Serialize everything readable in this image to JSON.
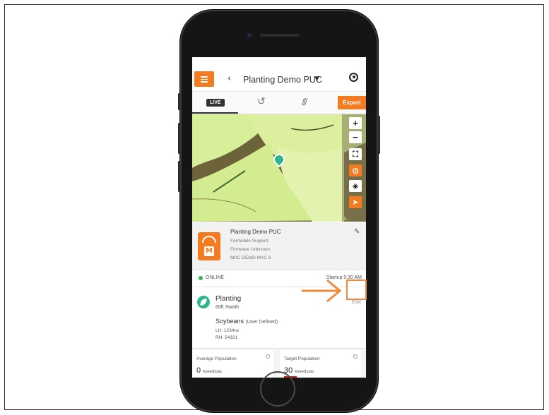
{
  "colors": {
    "accent": "#f47b20",
    "online": "#2fb55c",
    "crop_icon": "#2fb58b",
    "annotation": "#f08a3c"
  },
  "header": {
    "title": "Planting Demo PUC",
    "back_icon": "chevron-left-icon",
    "menu_icon": "hamburger-icon",
    "user_icon": "user-circle-icon"
  },
  "tabs": {
    "live_label": "LIVE",
    "history_icon": "history-icon",
    "coverage_icon": "stripes-icon",
    "export_label": "Export"
  },
  "map_controls": [
    {
      "name": "zoom-in-button",
      "glyph": "+"
    },
    {
      "name": "zoom-out-button",
      "glyph": "−"
    },
    {
      "name": "fullscreen-button",
      "glyph": "⛶"
    },
    {
      "name": "globe-button",
      "glyph": "◍"
    },
    {
      "name": "layers-button",
      "glyph": "◈"
    },
    {
      "name": "locate-button",
      "glyph": "➤"
    }
  ],
  "device": {
    "name": "Planting Demo PUC",
    "owner": "Farmobile Support",
    "firmware": "Firmware Unknown",
    "mac": "MAC DEMO MAC 6"
  },
  "status": {
    "state": "ONLINE",
    "startup": "Startup 9:30 AM"
  },
  "planting": {
    "title": "Planting",
    "swath": "60ft Swath",
    "crop": "Soybeans",
    "crop_note": "(User Defined)",
    "lh": "LH: 1234nx",
    "rh": "RH: 54321",
    "edit_label": "Edit"
  },
  "population": {
    "average": {
      "label": "Average Population",
      "value": "0",
      "unit": "kseeds/ac"
    },
    "target": {
      "label": "Target Population",
      "value": "30",
      "unit": "kseeds/ac"
    }
  }
}
